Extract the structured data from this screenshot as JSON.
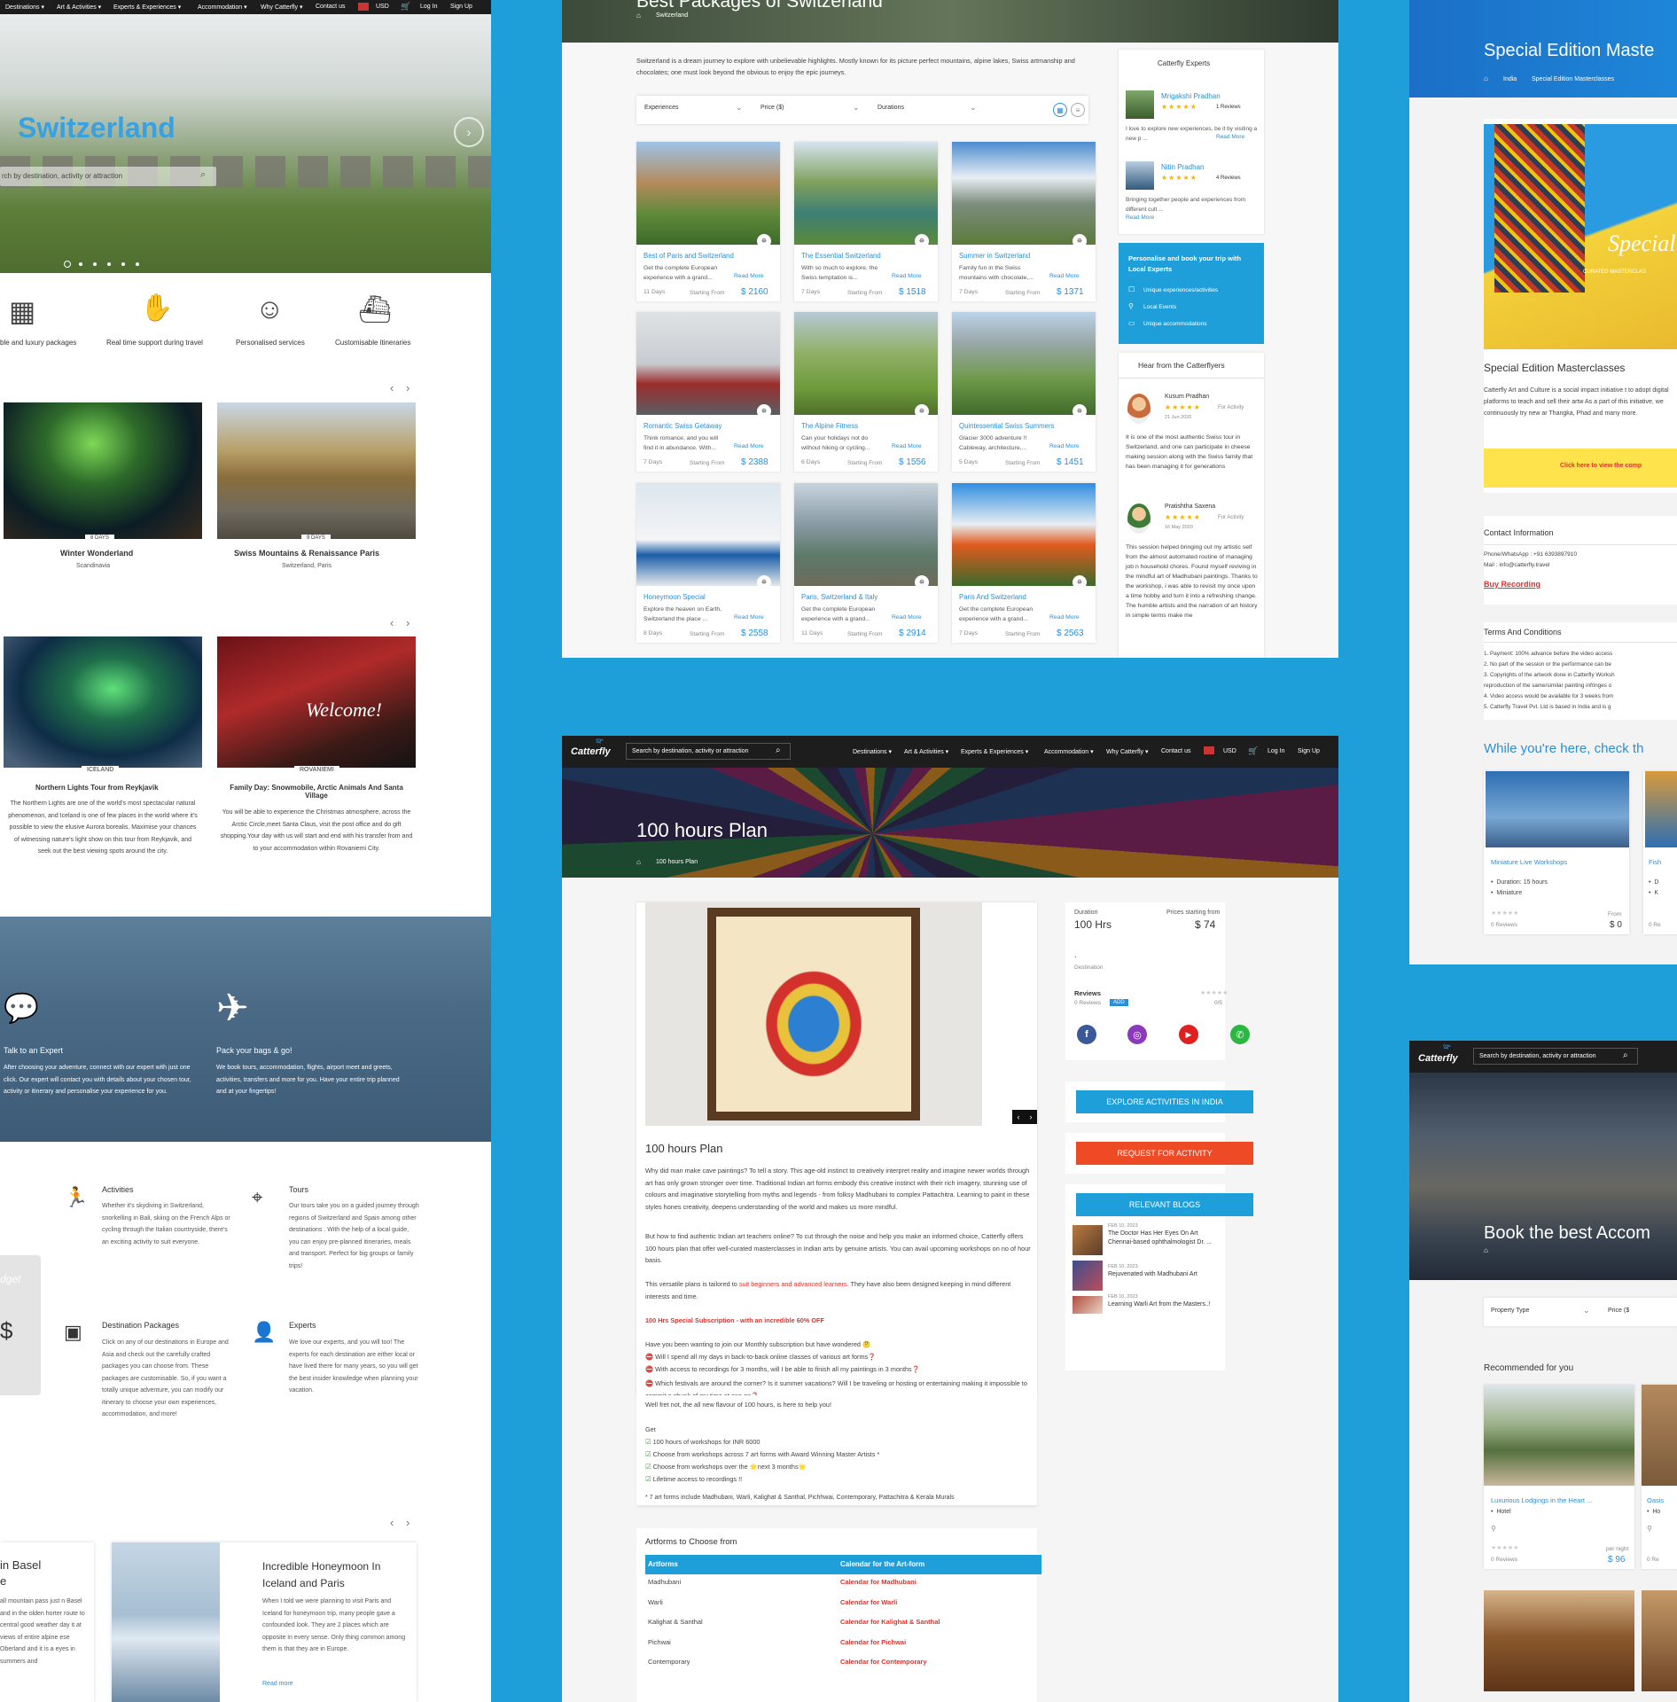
{
  "colors": {
    "background": "#1f9fda",
    "accent": "#2a8fd6",
    "red": "#e0312a",
    "yellow": "#ffe34d",
    "dark_nav": "#1d1d1d"
  },
  "p1": {
    "nav": [
      "Destinations ▾",
      "Art & Activities ▾",
      "Experts & Experiences ▾",
      "Accommodation ▾",
      "Why Catterfly ▾",
      "Contact us",
      "USD",
      "Log In",
      "Sign Up"
    ],
    "hero_title": "Switzerland",
    "search_placeholder": "rch by destination, activity or attraction",
    "features": [
      "ble and luxury packages",
      "Real time support during travel",
      "Personalised services",
      "Customisable itineraries"
    ],
    "tours1": [
      {
        "badge": "8 DAYS",
        "title": "Winter Wonderland",
        "loc": "Scandinavia"
      },
      {
        "badge": "9 DAYS",
        "title": "Swiss Mountains & Renaissance Paris",
        "loc": "Switzerland, Paris"
      }
    ],
    "tours2": [
      {
        "badge": "ICELAND",
        "title": "Northern Lights Tour from Reykjavik",
        "desc": "The Northern Lights are one of the world's most spectacular natural phenomenon, and Iceland is one of few places in the world where it's possible to view the elusive Aurora borealis. Maximise your chances of witnessing nature's light show on this tour from Reykjavik, and seek out the best viewing spots around the city."
      },
      {
        "badge": "ROVANIEMI",
        "title": "Family Day: Snowmobile, Arctic Animals And Santa Village",
        "desc": "You will be able to experience the Christmas atmosphere, across the Arctic Circle,meet Santa Claus, visit the post office and do gift shopping.Your day with us will start and end with his transfer from and to your accommodation within Rovaniemi City."
      }
    ],
    "steps": [
      {
        "title": "Talk to an Expert",
        "desc": "After choosing your adventure, connect with our expert with just one click. Our expert will contact you with details about your chosen tour, activity or itinerary and personalise your experience for you."
      },
      {
        "title": "Pack your bags & go!",
        "desc": "We book tours, accommodation, flights, airport meet and greets, activities, transfers and more for you. Have your entire trip planned and at your fingertips!"
      }
    ],
    "services": [
      {
        "title": "Activities",
        "desc": "Whether it's skydiving in Switzerland, snorkelling in Bali, skiing on the French Alps or cycling through the Italian countryside, there's an exciting activity to suit everyone."
      },
      {
        "title": "Tours",
        "desc": "Our tours take you on a guided journey through regions of Switzerland and Spain among other destinations . With the help of a local guide, you can enjoy pre-planned itineraries, meals and transport. Perfect for big groups or family trips!"
      },
      {
        "title": "Destination Packages",
        "desc": "Click on any of our destinations in Europe and Asia and check out the carefully crafted packages you can choose from. These packages are customisable. So, if you want a totally unique adventure, you can modify our itinerary to choose your own experiences, accommodation, and more!"
      },
      {
        "title": "Experts",
        "desc": "We love our experts, and you will too! The experts for each destination are either local or have lived there for many years, so you will get the best insider knowledge when planning your vacation."
      }
    ],
    "budget_label": "dget",
    "blog1": {
      "title": "in Basel",
      "sub": "e",
      "desc": "all mountain pass just n Basel and in the olden horter route to central good weather day it at views of entire alpine ese Oberland and it is a eyes in summers and"
    },
    "blog2": {
      "title": "Incredible Honeymoon In Iceland and Paris",
      "desc": "When I told we were planning to visit Paris and Iceland for honeymoon trip, many people gave a confounded look. They are 2 places which are opposite in every sense. Only thing common among them is that they are in Europe.",
      "more": "Read more"
    }
  },
  "p2": {
    "title": "Best Packages of Switzerland",
    "crumb": "Switzerland",
    "intro": "Switzerland is a dream journey to explore with unbelievable highlights. Mostly known for its picture perfect mountains, alpine lakes, Swiss artmanship and chocolates; one must look beyond the obvious to enjoy the epic journeys.",
    "filters": [
      "Experiences",
      "Price ($)",
      "Durations"
    ],
    "cards": [
      {
        "title": "Best of Paris and Switzerland",
        "desc": "Get the complete European experience with a grand...",
        "days": "11 Days",
        "price": "$ 2160"
      },
      {
        "title": "The Essential Switzerland",
        "desc": "With so much to explore, the Swiss temptation is...",
        "days": "7 Days",
        "price": "$ 1518"
      },
      {
        "title": "Summer in Switzerland",
        "desc": "Family fun in the Swiss mountains with chocolate,...",
        "days": "7 Days",
        "price": "$ 1371"
      },
      {
        "title": "Romantic Swiss Getaway",
        "desc": "Think romance, and you will find it in abundance. With...",
        "days": "7 Days",
        "price": "$ 2388"
      },
      {
        "title": "The Alpine Fitness",
        "desc": "Can your holidays not do without hiking or cycling...",
        "days": "6 Days",
        "price": "$ 1556"
      },
      {
        "title": "Quintessential Swiss Summers",
        "desc": "Glacier 3000 adventure !! Cableway, architecture,...",
        "days": "5 Days",
        "price": "$ 1451"
      },
      {
        "title": "Honeymoon Special",
        "desc": "Explore the heaven on Earth, Switzerland the place ...",
        "days": "8 Days",
        "price": "$ 2558"
      },
      {
        "title": "Paris, Switzerland & Italy",
        "desc": "Get the complete European experience with a grand...",
        "days": "11 Days",
        "price": "$ 2914"
      },
      {
        "title": "Paris And Switzerland",
        "desc": "Get the complete European experience with a grand...",
        "days": "7 Days",
        "price": "$ 2563"
      }
    ],
    "readmore": "Read More",
    "from": "Starting From",
    "experts_title": "Catterfly Experts",
    "experts": [
      {
        "name": "Mrigakshi Pradhan",
        "reviews": "1 Reviews",
        "desc": "I love to explore new experiences, be it by visiting a new p ...",
        "more": "Read More"
      },
      {
        "name": "Nitin Pradhan",
        "reviews": "4 Reviews",
        "desc": "Bringing together people and experiences from different cult ...",
        "more": "Read More"
      }
    ],
    "promo": {
      "title": "Personalise and book your trip with Local Experts",
      "items": [
        "Unique experiences/activities",
        "Local Events",
        "Unique accommodations"
      ]
    },
    "hear_title": "Hear from the Catterflyers",
    "reviews": [
      {
        "name": "Kusum Pradhan",
        "tag": "For Activity",
        "date": "21 Jun 2020",
        "text": "It is one of the most authentic Swiss tour in Switzerland, and one can participate in cheese making session along with the Swiss family that has been managing it for generations"
      },
      {
        "name": "Pratishtha Saxena",
        "tag": "For Activity",
        "date": "16 May 2020",
        "text": "This session helped bringing out my artistic self from the almost automated routine of managing job n household chores. Found myself reviving in the mindful art of Madhubani paintings. Thanks to the workshop, i was able to revisit my once upon a time hobby and turn it into a refreshing change. The humble artists and the narration of art history in simple terms make me"
      }
    ]
  },
  "p3": {
    "logo": "Catterfly",
    "search": "Search by destination, activity or attraction",
    "nav": [
      "Destinations ▾",
      "Art & Activities ▾",
      "Experts & Experiences ▾",
      "Accommodation ▾",
      "Why Catterfly ▾",
      "Contact us",
      "USD",
      "Log In",
      "Sign Up"
    ],
    "hero_title": "100 hours Plan",
    "crumb": "100 hours Plan",
    "content_title": "100 hours Plan",
    "p1": "Why did man make cave paintings? To tell a story. This age-old instinct to creatively interpret reality and imagine newer worlds through art has only grown stronger over time. Traditional Indian art forms embody this creative instinct with their rich imagery, stunning use of colours and imaginative storytelling from myths and legends - from folksy Madhubani to complex Pattachitra. Learning to paint in these styles hones creativity, deepens understanding of the world and makes us more mindful.",
    "p2": "But how to find authentic Indian art teachers online? To cut through the noise and help you make an informed choice, Catterfly offers 100 hours plan that offer well-curated masterclasses in Indian arts by genuine artists. You can avail upcoming workshops on no of hour basis.",
    "p3a": "This versatile plans is tailored to ",
    "p3b": "suit beginners and advanced learners.",
    "p3c": " They have also been designed keeping in mind different interests and time.",
    "offer": "100 Hrs Special Subscription - with an incredible 60% OFF",
    "q_intro": "Have you been wanting to join our Monthly subscription but have wondered 🤔",
    "qs": [
      "Will I spend all my days in back-to-back online classes of various art forms❓",
      "With access to recordings for 3 months, will I be able to finish all my paintings in 3 months❓",
      "Which festivals are around the corner? Is it summer vacations? Will I be traveling or hosting or entertaining making it impossible to commit a chunk of my time at one go❓"
    ],
    "fret": "Well fret not, the all new flavour of 100 hours, is here to help you!",
    "get": "Get",
    "gets": [
      "100 hours of workshops for INR 6000",
      "Choose from workshops across 7 art forms with Award Winning Master Artists *",
      "Choose from workshops over the 🌟next 3 months🌟",
      "Lifetime access to recordings !!"
    ],
    "foot": "* 7 art forms include Madhubani, Warli, Kalighat & Santhal, Pichhwai, Contemporary, Pattachitra & Kerala Murals",
    "side": {
      "duration_label": "Duration",
      "duration": "100 Hrs",
      "price_label": "Prices starting from",
      "price": "$ 74",
      "dest_dot": ".",
      "dest_label": "Destination",
      "reviews_label": "Reviews",
      "reviews_count": "0 Reviews",
      "add": "ADD",
      "score": "0/5"
    },
    "buttons": [
      "EXPLORE ACTIVITIES IN INDIA",
      "REQUEST FOR ACTIVITY",
      "RELEVANT BLOGS"
    ],
    "blogs": [
      {
        "date": "FEB 10, 2023",
        "title": "The Doctor Has Her Eyes On Art",
        "sub": "Chennai-based ophthalmologist Dr. ..."
      },
      {
        "date": "FEB 10, 2023",
        "title": "Rejuvenated with Madhubani Art",
        "sub": ""
      },
      {
        "date": "FEB 10, 2023",
        "title": "Learning Warli Art from the Masters..!",
        "sub": ""
      }
    ],
    "artforms_title": "Artforms to Choose from",
    "table_head": [
      "Artforms",
      "Calendar for the Art-form"
    ],
    "rows": [
      [
        "Madhubani",
        "Calendar for Madhubani"
      ],
      [
        "Warli",
        "Calendar for Warli"
      ],
      [
        "Kalighat & Santhal",
        "Calendar for Kalighat & Santhal"
      ],
      [
        "Pichwai",
        "Calendar for Pichwai"
      ],
      [
        "Contemporary",
        "Calendar for Contemporary"
      ]
    ]
  },
  "p4": {
    "title": "Special Edition Maste",
    "crumb1": "India",
    "crumb2": "Special Edition Masterclasses",
    "poster_text": "Special E",
    "poster_sub": "CURATED MASTERCLAS",
    "heading": "Special Edition Masterclasses",
    "desc": "Catterfly Art and Culture is a social impact initiative t to adopt digital platforms to teach and sell their artw As a part of this initiative, we continuously try new ar Thangka, Phad and many more.",
    "cta": "Click here to view the comp",
    "contact_title": "Contact Information",
    "phone": "Phone/WhatsApp : +91 6393897910",
    "mail": "Mail : info@catterfly.travel",
    "buy": "Buy Recording",
    "terms_title": "Terms And Conditions",
    "terms": [
      "1. Payment: 100% advance before the video access",
      "2. No part of the session or the performance can be",
      "3. Copyrights of the artwork done in Catterfly Worksh",
      "reproduction of the same/similar painting infringes o",
      "4. Video access would be available for 3 weeks from",
      "5. Catterfly Travel Pvt. Ltd is based in India and is g"
    ],
    "while": "While you're here, check th",
    "card": {
      "title": "Miniature Live Workshops",
      "d1": "Duration:  15 hours",
      "d2": "Miniature",
      "reviews": "0 Reviews",
      "from": "From",
      "price": "$ 0"
    },
    "card2": {
      "title": "Fish",
      "d1": "D",
      "d2": "K",
      "reviews": "0 Re"
    }
  },
  "p5": {
    "logo": "Catterfly",
    "search": "Search by destination, activity or attraction",
    "hero": "Book the best Accom",
    "filters": [
      "Property Type",
      "Price ($"
    ],
    "rec": "Recommended for you",
    "card": {
      "title": "Luxurious Lodgings in the Heart ...",
      "type": "Hotel",
      "reviews": "0 Reviews",
      "per": "per night",
      "price": "$ 96"
    },
    "card2": {
      "title": "Oasis",
      "type": "Ho",
      "reviews": "0 Re"
    }
  }
}
